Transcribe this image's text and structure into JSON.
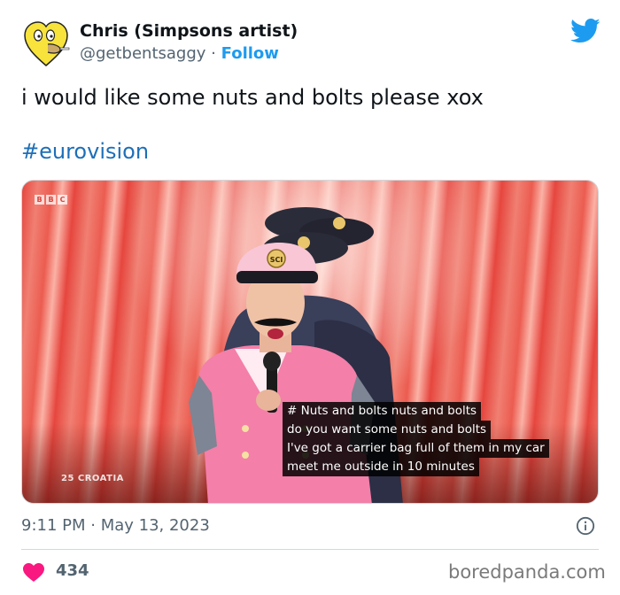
{
  "author": {
    "display_name": "Chris (Simpsons artist)",
    "handle": "@getbentsaggy",
    "separator": "·",
    "follow_label": "Follow",
    "avatar_icon": "yellow-heart-face-icon"
  },
  "brand": {
    "logo_icon": "twitter-bird-icon",
    "logo_color": "#1d9bf0"
  },
  "tweet": {
    "text": "i would like some nuts and bolts please xox",
    "hashtag": "#eurovision"
  },
  "media": {
    "broadcaster_logo": [
      "B",
      "B",
      "C"
    ],
    "country_tag": "25 CROATIA",
    "cap_badge": "SCI",
    "subtitles": [
      "# Nuts and bolts nuts and bolts",
      "do you want some nuts and bolts",
      "I've got a carrier bag full of them in my car",
      "meet me outside in 10 minutes"
    ]
  },
  "footer": {
    "timestamp": "9:11 PM · May 13, 2023",
    "info_icon": "info-icon",
    "like_icon": "heart-icon",
    "like_color": "#f91880",
    "like_count": "434"
  },
  "watermark": "boredpanda.com"
}
